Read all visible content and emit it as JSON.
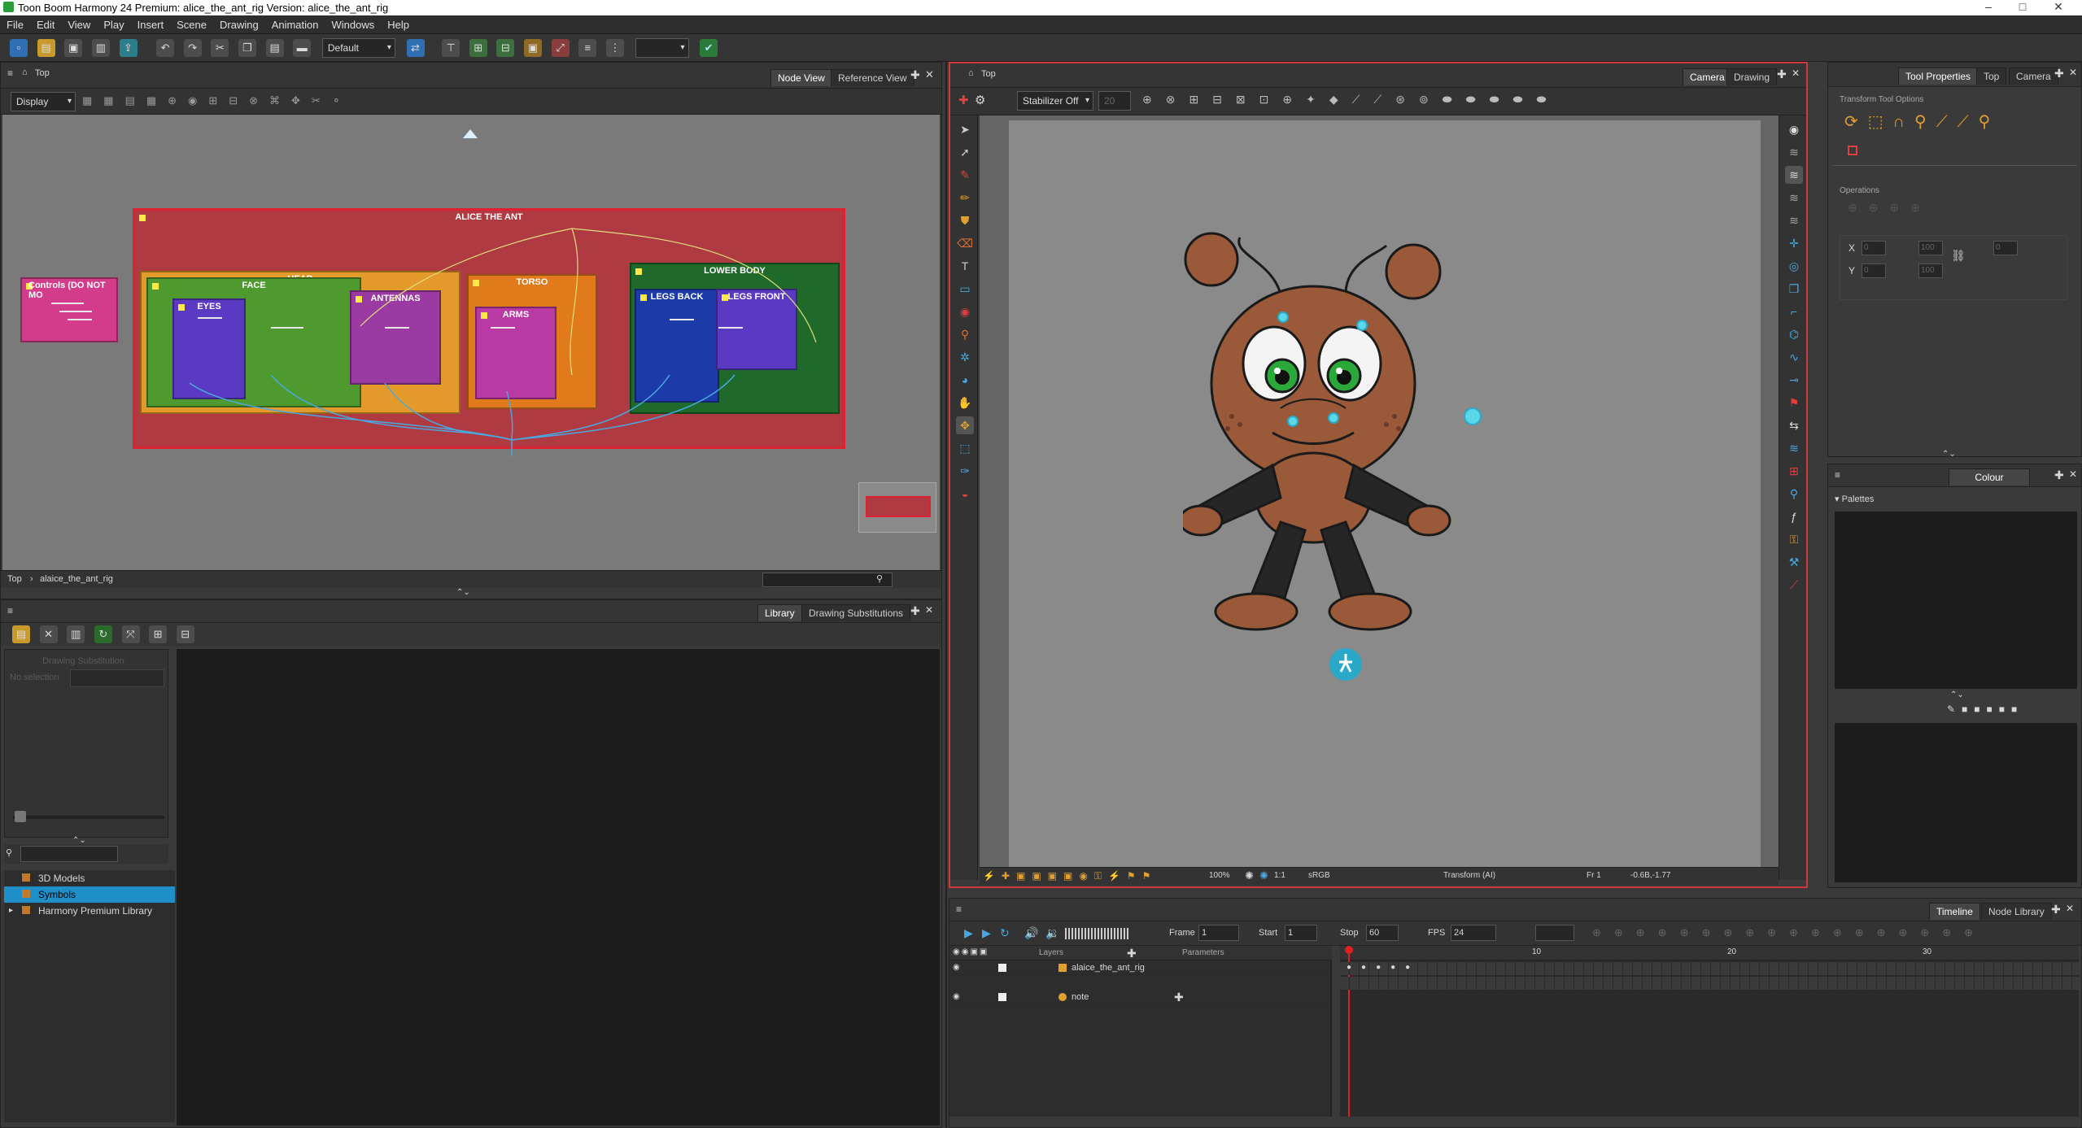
{
  "window": {
    "title": "Toon Boom Harmony 24 Premium: alice_the_ant_rig Version: alice_the_ant_rig"
  },
  "menu": [
    "File",
    "Edit",
    "View",
    "Play",
    "Insert",
    "Scene",
    "Drawing",
    "Animation",
    "Windows",
    "Help"
  ],
  "toolbar": {
    "workspace_value": "Default"
  },
  "node_view": {
    "tabs": [
      "Node View",
      "Reference View"
    ],
    "location": "Top",
    "display_value": "Display",
    "breadcrumb_root": "Top",
    "breadcrumb_current": "alaice_the_ant_rig",
    "groups": {
      "main": "ALICE THE ANT",
      "controls": "Controls (DO NOT MO",
      "head": "HEAD",
      "face": "FACE",
      "eyes": "EYES",
      "antennas": "ANTENNAS",
      "torso": "TORSO",
      "arms": "ARMS",
      "lower_body": "LOWER BODY",
      "legs_back": "LEGS BACK",
      "legs_front": "LEGS FRONT"
    }
  },
  "library": {
    "tabs": [
      "Library",
      "Drawing Substitutions"
    ],
    "drawing_substitution": "Drawing Substitution",
    "no_selection": "No selection",
    "items": [
      "3D Models",
      "Symbols",
      "Harmony Premium Library"
    ]
  },
  "camera_view": {
    "tabs": [
      "Camera",
      "Drawing"
    ],
    "location": "Top",
    "stabilizer_value": "Stabilizer Off",
    "stabilizer_num": "20",
    "zoom": "100%",
    "ratio": "1:1",
    "colorspace": "sRGB",
    "status_tool": "Transform (AI)",
    "status_frame": "Fr 1",
    "status_coords": "-0.6B,-1.77"
  },
  "tool_properties": {
    "tabs": [
      "Tool Properties",
      "Top",
      "Camera"
    ],
    "section": "Transform Tool Options",
    "operations": "Operations",
    "fields": {
      "x": "0",
      "y": "0",
      "w": "100",
      "h": "100",
      "angle": "0"
    }
  },
  "colour": {
    "tab": "Colour",
    "palettes_label": "Palettes"
  },
  "timeline": {
    "tabs": [
      "Timeline",
      "Node Library"
    ],
    "frame_label": "Frame",
    "frame_value": "1",
    "start_label": "Start",
    "start_value": "1",
    "stop_label": "Stop",
    "stop_value": "60",
    "fps_label": "FPS",
    "fps_value": "24",
    "layers_header": "Layers",
    "params_header": "Parameters",
    "layers": [
      "alaice_the_ant_rig",
      "note"
    ],
    "frame_marks": [
      "10",
      "20",
      "30"
    ]
  },
  "colors": {
    "accent": "#d03a3a",
    "selection": "#1f8fc8"
  }
}
